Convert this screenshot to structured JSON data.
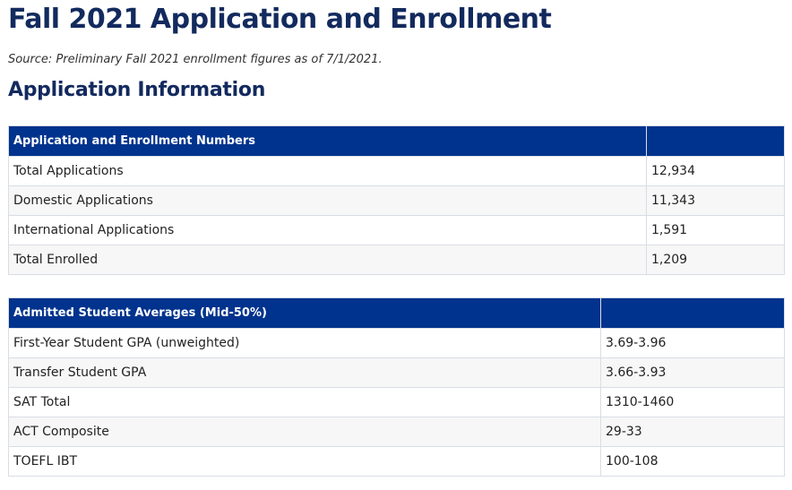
{
  "page": {
    "title": "Fall 2021 Application and Enrollment",
    "source": "Source: Preliminary Fall 2021 enrollment figures as of 7/1/2021.",
    "section_heading": "Application Information"
  },
  "table1": {
    "header": "Application and Enrollment Numbers",
    "header_value": "",
    "rows": [
      {
        "label": "Total Applications",
        "value": "12,934"
      },
      {
        "label": "Domestic Applications",
        "value": "11,343"
      },
      {
        "label": "International Applications",
        "value": "1,591"
      },
      {
        "label": "Total Enrolled",
        "value": "1,209"
      }
    ]
  },
  "table2": {
    "header": "Admitted Student Averages (Mid-50%)",
    "header_value": "",
    "rows": [
      {
        "label": "First-Year Student GPA (unweighted)",
        "value": "3.69-3.96"
      },
      {
        "label": "Transfer Student GPA",
        "value": "3.66-3.93"
      },
      {
        "label": "SAT Total",
        "value": "1310-1460"
      },
      {
        "label": "ACT Composite",
        "value": "29-33"
      },
      {
        "label": "TOEFL IBT",
        "value": "100-108"
      }
    ]
  },
  "colors": {
    "heading": "#132a5e",
    "table_header_bg": "#00338d",
    "row_stripe": "#f7f7f7",
    "border": "#d8dde6"
  }
}
